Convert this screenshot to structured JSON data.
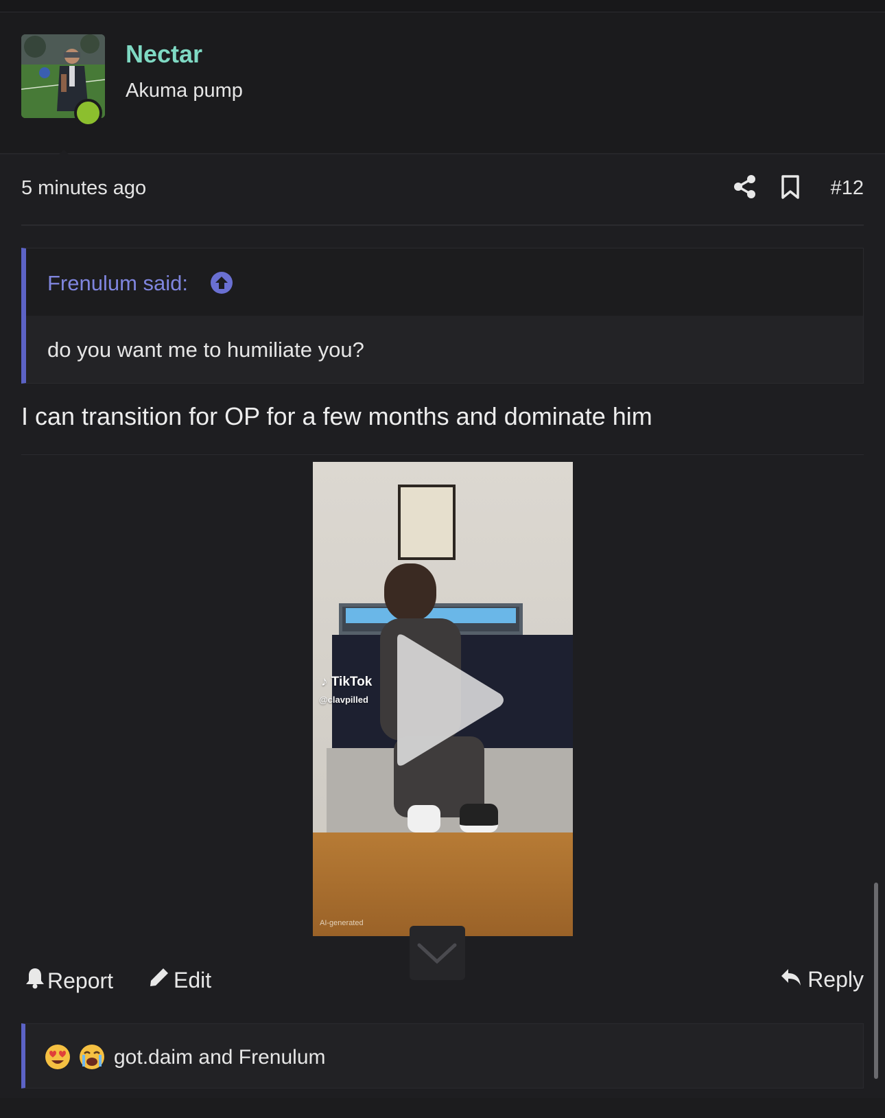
{
  "colors": {
    "accent": "#5c63c6",
    "username": "#7fd9c3",
    "quote_author": "#7f85de",
    "online": "#8cbf2e",
    "background": "#1e1e21"
  },
  "user": {
    "name": "Nectar",
    "title": "Akuma pump",
    "status": "online"
  },
  "post": {
    "time": "5 minutes ago",
    "number": "#12",
    "share_icon": "share-icon",
    "bookmark_icon": "bookmark-icon",
    "quote": {
      "author": "Frenulum said:",
      "text": "do you want me to humiliate you?"
    },
    "text": "I can transition for OP for a few months and dominate him",
    "video": {
      "platform": "TikTok",
      "handle": "@clavpilled",
      "badge": "AI-generated"
    }
  },
  "actions": {
    "report": "Report",
    "edit": "Edit",
    "reply": "Reply"
  },
  "reactions": {
    "emojis": [
      "😍",
      "😭"
    ],
    "text": "got.daim and Frenulum"
  }
}
